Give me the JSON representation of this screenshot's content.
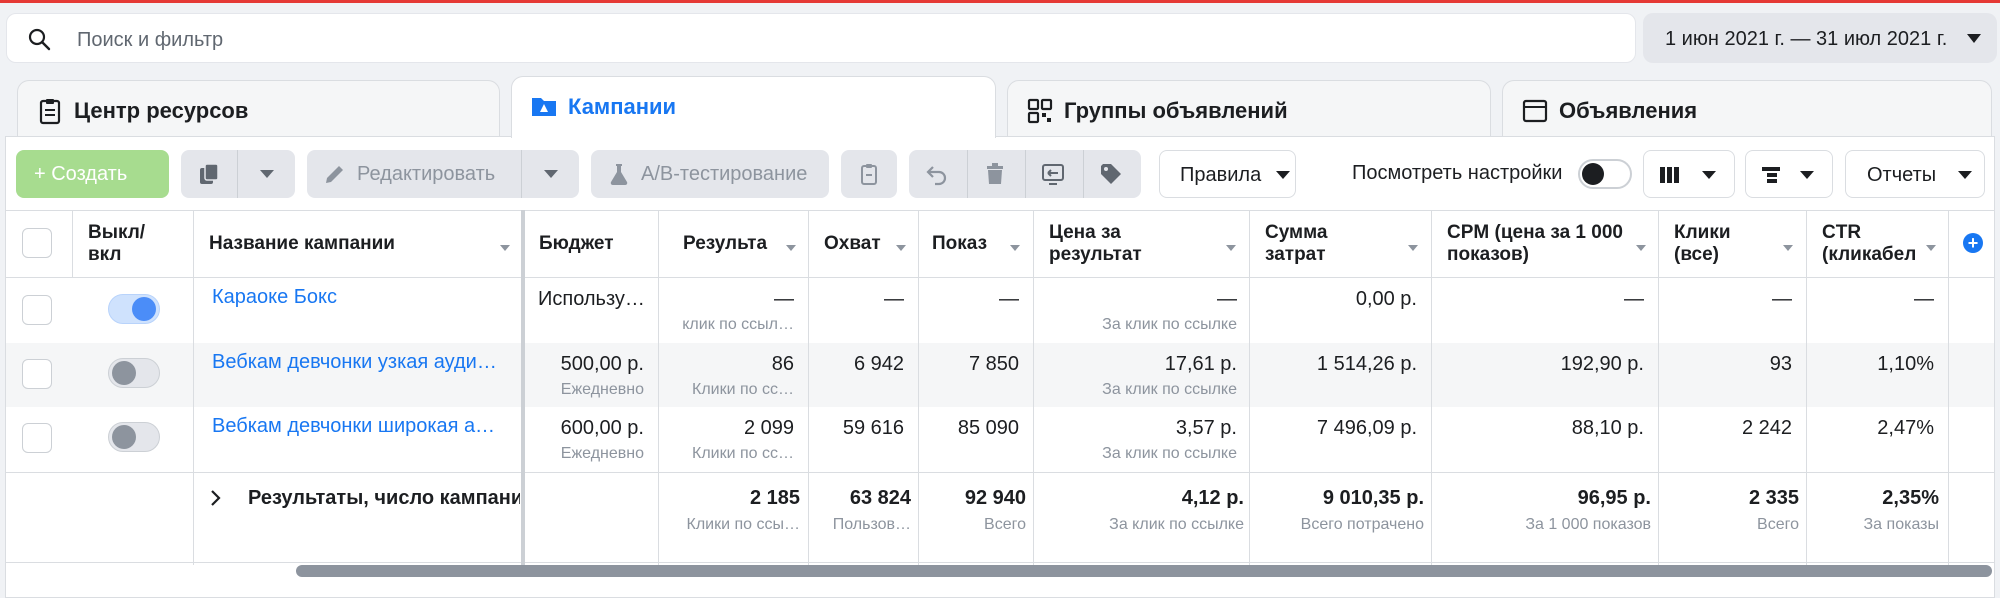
{
  "search": {
    "placeholder": "Поиск и фильтр"
  },
  "date_range": "1 июн 2021 г. — 31 июл 2021 г.",
  "tabs": [
    {
      "label": "Центр ресурсов",
      "icon": "clipboard-icon"
    },
    {
      "label": "Кампании",
      "icon": "folder-icon"
    },
    {
      "label": "Группы объявлений",
      "icon": "grid-icon"
    },
    {
      "label": "Объявления",
      "icon": "window-icon"
    }
  ],
  "toolbar": {
    "create": "+  Создать",
    "edit": "Редактировать",
    "ab_test": "A/B-тестирование",
    "rules": "Правила",
    "view_settings": "Посмотреть настройки",
    "reports": "Отчеты"
  },
  "columns": {
    "onoff": "Выкл/ вкл",
    "name": "Название кампании",
    "budget": "Бюджет",
    "results": "Результа",
    "reach": "Охват",
    "impressions": "Показ",
    "cost_per_result": "Цена за результат",
    "amount_spent": "Сумма затрат",
    "cpm": "CPM (цена за 1 000 показов)",
    "clicks": "Клики (все)",
    "ctr": "CTR (кликабел"
  },
  "rows": [
    {
      "on": true,
      "name": "Караоке Бокс",
      "budget": "Использу…",
      "budget_sub": "",
      "results": "—",
      "results_sub": "клик по ссыл…",
      "reach": "—",
      "impressions": "—",
      "cost": "—",
      "cost_sub": "За клик по ссылке",
      "spent": "0,00 р.",
      "cpm": "—",
      "clicks": "—",
      "ctr": "—"
    },
    {
      "on": false,
      "name": "Вебкам девчонки узкая аудит…",
      "budget": "500,00 р.",
      "budget_sub": "Ежедневно",
      "results": "86",
      "results_sub": "Клики по сс…",
      "reach": "6 942",
      "impressions": "7 850",
      "cost": "17,61 р.",
      "cost_sub": "За клик по ссылке",
      "spent": "1 514,26 р.",
      "cpm": "192,90 р.",
      "clicks": "93",
      "ctr": "1,10%"
    },
    {
      "on": false,
      "name": "Вебкам девчонки широкая ау…",
      "budget": "600,00 р.",
      "budget_sub": "Ежедневно",
      "results": "2 099",
      "results_sub": "Клики по сс…",
      "reach": "59 616",
      "impressions": "85 090",
      "cost": "3,57 р.",
      "cost_sub": "За клик по ссылке",
      "spent": "7 496,09 р.",
      "cpm": "88,10 р.",
      "clicks": "2 242",
      "ctr": "2,47%"
    }
  ],
  "totals": {
    "label": "Результаты, число кампани",
    "results": "2 185",
    "results_sub": "Клики по ссы…",
    "reach": "63 824",
    "reach_sub": "Пользов…",
    "impressions": "92 940",
    "impressions_sub": "Всего",
    "cost": "4,12 р.",
    "cost_sub": "За клик по ссылке",
    "spent": "9 010,35 р.",
    "spent_sub": "Всего потрачено",
    "cpm": "96,95 р.",
    "cpm_sub": "За 1 000 показов",
    "clicks": "2 335",
    "clicks_sub": "Всего",
    "ctr": "2,35%",
    "ctr_sub": "За показы"
  }
}
